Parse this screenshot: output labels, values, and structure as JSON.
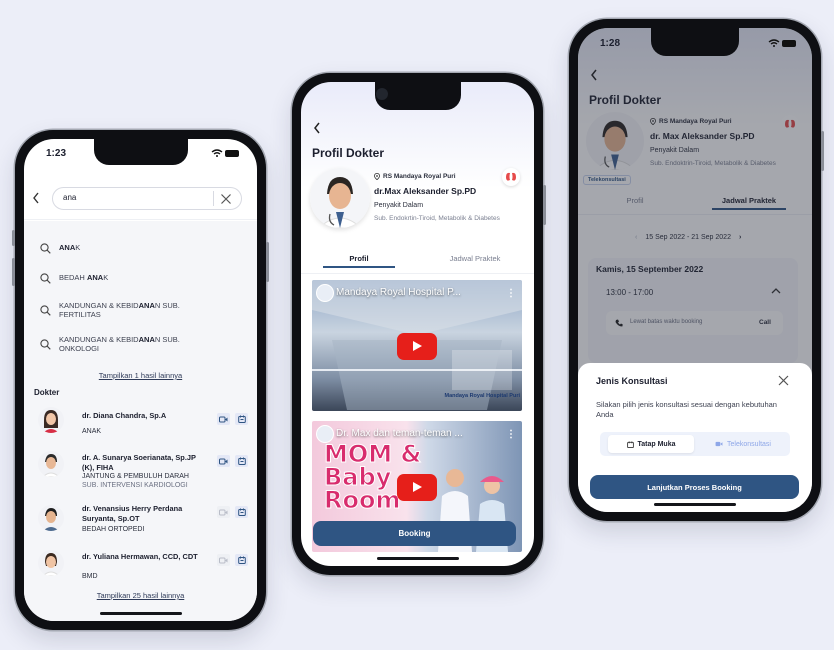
{
  "colors": {
    "primary": "#2f5583",
    "accent": "#3a5ef0",
    "background": "#eceef8",
    "youtube_red": "#e61f1a"
  },
  "phone1": {
    "time": "1:23",
    "search": {
      "value": "ana"
    },
    "suggestions": [
      {
        "bold": "ANA",
        "rest": "K",
        "line2": ""
      },
      {
        "pre": "BEDAH ",
        "bold": "ANA",
        "rest": "K",
        "line2": ""
      },
      {
        "pre": "KANDUNGAN & KEBID",
        "bold": "ANA",
        "rest": "N SUB.",
        "line2": "FERTILITAS"
      },
      {
        "pre": "KANDUNGAN & KEBID",
        "bold": "ANA",
        "rest": "N SUB.",
        "line2": "ONKOLOGI"
      }
    ],
    "more_link": "Tampilkan 1 hasil lainnya",
    "section_title": "Dokter",
    "doctors": [
      {
        "name": "dr. Diana Chandra, Sp.A",
        "specialty": "ANAK",
        "sub": ""
      },
      {
        "name": "dr. A. Sunarya Soerianata, Sp.JP (K), FIHA",
        "specialty": "JANTUNG & PEMBULUH DARAH",
        "sub": "SUB. INTERVENSI KARDIOLOGI"
      },
      {
        "name": "dr. Venansius Herry Perdana Suryanta, Sp.OT",
        "specialty": "BEDAH ORTOPEDI",
        "sub": ""
      },
      {
        "name": "dr. Yuliana Hermawan, CCD, CDT",
        "specialty": "BMD",
        "sub": ""
      }
    ],
    "more_doctors_link": "Tampilkan 25 hasil lainnya"
  },
  "phone2": {
    "title": "Profil Dokter",
    "hospital": "RS Mandaya Royal Puri",
    "doctor_name": "dr.Max Aleksander Sp.PD",
    "specialty": "Penyakit Dalam",
    "sub": "Sub. Endokrtin-Tiroid, Metabolik & Diabetes",
    "tabs": [
      "Profil",
      "Jadwal Praktek"
    ],
    "active_tab": "Profil",
    "videos": [
      {
        "title": "Mandaya Royal Hospital P...",
        "overlay": "Mandaya Royal Hospital Puri"
      },
      {
        "title": "Dr. Max dan teman-teman ...",
        "overlay1": "MOM &",
        "overlay2": "Baby",
        "overlay3": "Room"
      }
    ],
    "booking_label": "Booking"
  },
  "phone3": {
    "time": "1:28",
    "title": "Profil Dokter",
    "hospital": "RS Mandaya Royal Puri",
    "doctor_name": "dr. Max Aleksander Sp.PD",
    "specialty": "Penyakit Dalam",
    "sub": "Sub. Endoktrin-Tiroid, Metabolik & Diabetes",
    "badge": "Telekonsultasi",
    "tabs": [
      "Profil",
      "Jadwal Praktek"
    ],
    "active_tab": "Jadwal Praktek",
    "date_range": "15 Sep 2022 - 21 Sep 2022",
    "day": "Kamis, 15 September 2022",
    "slot": "13:00 - 17:00",
    "notice": "Lewat batas waktu booking",
    "call": "Call",
    "sheet": {
      "title": "Jenis Konsultasi",
      "desc": "Silakan pilih jenis konsultasi sesuai dengan kebutuhan Anda",
      "options": [
        "Tatap Muka",
        "Telekonsultasi"
      ],
      "selected": "Tatap Muka",
      "cta": "Lanjutkan Proses Booking"
    }
  }
}
